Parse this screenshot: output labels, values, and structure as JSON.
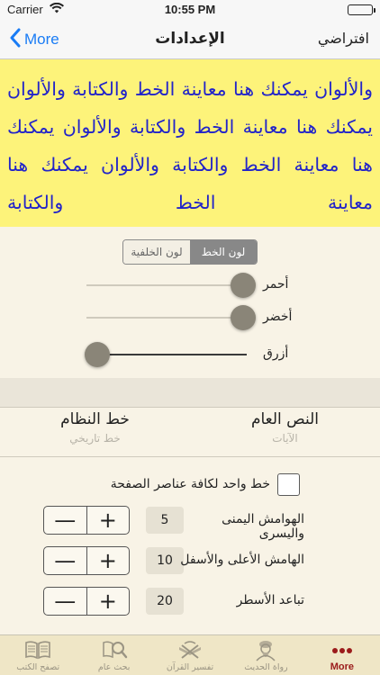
{
  "status_bar": {
    "carrier": "Carrier",
    "time": "10:55 PM"
  },
  "nav": {
    "back_label": "More",
    "title": "الإعدادات",
    "defaults_label": "افتراضي"
  },
  "preview": {
    "text": "والألوان يمكنك هنا معاينة الخط والكتابة والألوان يمكنك هنا معاينة الخط والكتابة والألوان يمكنك هنا معاينة الخط والكتابة والألوان يمكنك هنا معاينة الخط والكتابة",
    "background_color": "#fdf37a",
    "text_color": "#2224c9"
  },
  "color_settings": {
    "segments": [
      {
        "label": "لون الخلفية",
        "selected": false
      },
      {
        "label": "لون الخط",
        "selected": true
      }
    ],
    "sliders": [
      {
        "label": "أحمر",
        "value": 0.98
      },
      {
        "label": "أخضر",
        "value": 0.98
      },
      {
        "label": "أزرق",
        "value": 0.07
      }
    ]
  },
  "font_pickers": {
    "system_font": {
      "selected": "خط النظام",
      "next": "خط تاريخي"
    },
    "general_text": {
      "selected": "النص العام",
      "next": "الآيات"
    }
  },
  "layout_settings": {
    "single_font_label": "خط واحد لكافة عناصر الصفحة",
    "single_font_checked": false,
    "steppers": [
      {
        "label": "الهوامش اليمنى واليسرى",
        "value": "5"
      },
      {
        "label": "الهامش الأعلى والأسفل",
        "value": "10"
      },
      {
        "label": "تباعد الأسطر",
        "value": "20"
      }
    ],
    "minus_symbol": "—",
    "plus_symbol": "+"
  },
  "tabs": [
    {
      "label": "تصفح الكتب",
      "icon": "book-icon",
      "active": false
    },
    {
      "label": "بحث عام",
      "icon": "search-book-icon",
      "active": false
    },
    {
      "label": "تفسير القرآن",
      "icon": "quran-stand-icon",
      "active": false
    },
    {
      "label": "رواة الحديث",
      "icon": "scholar-icon",
      "active": false
    },
    {
      "label": "More",
      "icon": "more-dots-icon",
      "active": true
    }
  ],
  "colors": {
    "accent": "#1a7cf5",
    "active_tab": "#9b1b1b",
    "tab_inactive": "#9a9483"
  }
}
